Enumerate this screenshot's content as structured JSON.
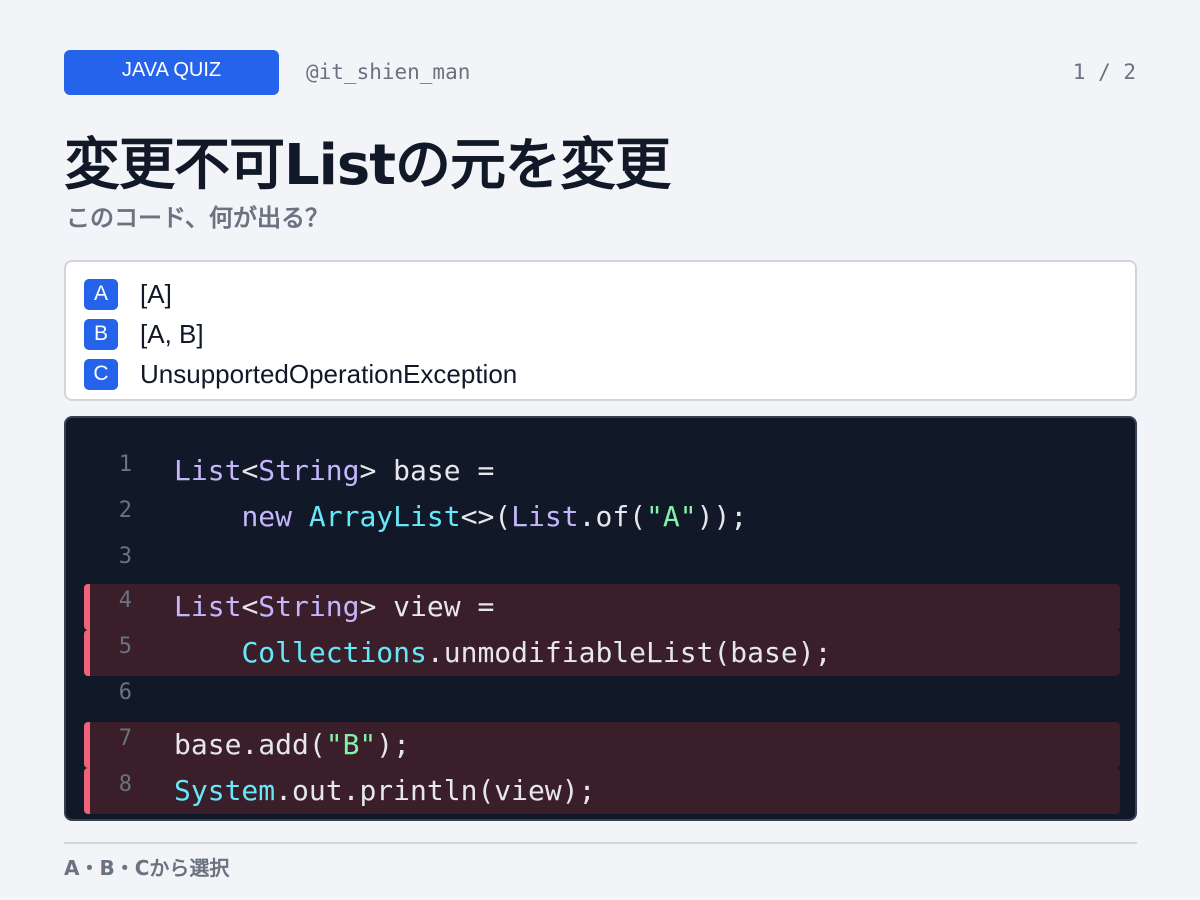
{
  "header": {
    "badge": "JAVA QUIZ",
    "handle": "@it_shien_man",
    "page": "1 / 2"
  },
  "title": "変更不可Listの元を変更",
  "subtitle": "このコード、何が出る？",
  "options": [
    {
      "letter": "A",
      "text": "[A]"
    },
    {
      "letter": "B",
      "text": "[A, B]"
    },
    {
      "letter": "C",
      "text": "UnsupportedOperationException"
    }
  ],
  "code": {
    "lines": [
      {
        "n": "1",
        "highlight": false,
        "tokens": [
          {
            "c": "k",
            "t": "List"
          },
          {
            "c": "p",
            "t": "<"
          },
          {
            "c": "k",
            "t": "String"
          },
          {
            "c": "p",
            "t": "> base ="
          }
        ]
      },
      {
        "n": "2",
        "highlight": false,
        "tokens": [
          {
            "c": "p",
            "t": "    "
          },
          {
            "c": "k",
            "t": "new"
          },
          {
            "c": "p",
            "t": " "
          },
          {
            "c": "t",
            "t": "ArrayList"
          },
          {
            "c": "p",
            "t": "<>("
          },
          {
            "c": "k",
            "t": "List"
          },
          {
            "c": "p",
            "t": ".of("
          },
          {
            "c": "s",
            "t": "\"A\""
          },
          {
            "c": "p",
            "t": "));"
          }
        ]
      },
      {
        "n": "3",
        "highlight": false,
        "tokens": []
      },
      {
        "n": "4",
        "highlight": true,
        "tokens": [
          {
            "c": "k",
            "t": "List"
          },
          {
            "c": "p",
            "t": "<"
          },
          {
            "c": "k",
            "t": "String"
          },
          {
            "c": "p",
            "t": "> view ="
          }
        ]
      },
      {
        "n": "5",
        "highlight": true,
        "tokens": [
          {
            "c": "p",
            "t": "    "
          },
          {
            "c": "t",
            "t": "Collections"
          },
          {
            "c": "p",
            "t": ".unmodifiableList(base);"
          }
        ]
      },
      {
        "n": "6",
        "highlight": false,
        "tokens": []
      },
      {
        "n": "7",
        "highlight": true,
        "tokens": [
          {
            "c": "p",
            "t": "base.add("
          },
          {
            "c": "s",
            "t": "\"B\""
          },
          {
            "c": "p",
            "t": ");"
          }
        ]
      },
      {
        "n": "8",
        "highlight": true,
        "tokens": [
          {
            "c": "t",
            "t": "System"
          },
          {
            "c": "p",
            "t": ".out.println(view);"
          }
        ]
      }
    ]
  },
  "footer": "A・B・Cから選択",
  "colors": {
    "accent": "#2563eb",
    "highlight_bar": "#f0627a",
    "code_bg": "#111827"
  }
}
